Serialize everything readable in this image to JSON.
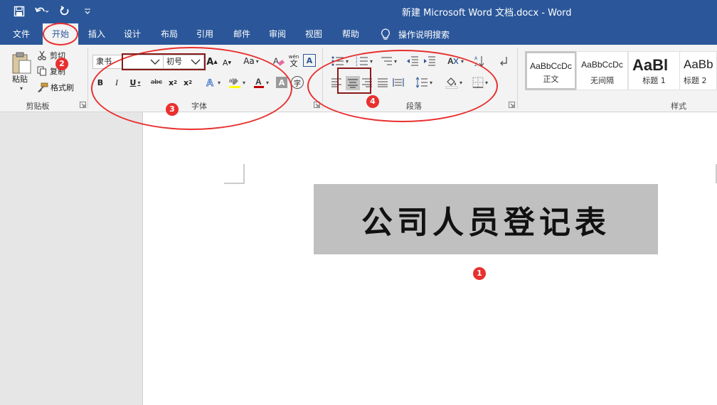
{
  "window": {
    "title": "新建 Microsoft Word 文档.docx  -  Word"
  },
  "tabs": [
    {
      "label": "文件"
    },
    {
      "label": "开始",
      "active": true
    },
    {
      "label": "插入"
    },
    {
      "label": "设计"
    },
    {
      "label": "布局"
    },
    {
      "label": "引用"
    },
    {
      "label": "邮件"
    },
    {
      "label": "审阅"
    },
    {
      "label": "视图"
    },
    {
      "label": "帮助"
    }
  ],
  "tell_me": {
    "label": "操作说明搜索"
  },
  "clipboard": {
    "paste_label": "粘贴",
    "cut_label": "剪切",
    "copy_label": "复制",
    "format_painter_label": "格式刷",
    "group_label": "剪贴板"
  },
  "font": {
    "font_name": "隶书",
    "font_size": "初号",
    "case_label": "Aa",
    "phonetic_label": "wén",
    "group_label": "字体"
  },
  "paragraph": {
    "group_label": "段落"
  },
  "styles": {
    "group_label": "样式",
    "items": [
      {
        "sample": "AaBbCcDc",
        "name": "正文"
      },
      {
        "sample": "AaBbCcDc",
        "name": "无间隔"
      },
      {
        "sample": "AaBl",
        "name": "标题 1"
      },
      {
        "sample": "AaBb",
        "name": "标题 2"
      }
    ]
  },
  "document": {
    "title_text": "公司人员登记表"
  },
  "annotations": {
    "badge1": "1",
    "badge2": "2",
    "badge3": "3",
    "badge4": "4"
  },
  "colors": {
    "titlebar": "#2b579a",
    "annotation_red": "#e8302f",
    "annotation_darkred": "#8b1a1a",
    "highlight_yellow": "#ffff00",
    "font_color_red": "#c00000"
  },
  "icons": {
    "save": "save-icon",
    "undo": "undo-icon",
    "redo": "redo-icon",
    "customize": "customize-qat-icon",
    "lightbulb": "lightbulb-icon"
  }
}
